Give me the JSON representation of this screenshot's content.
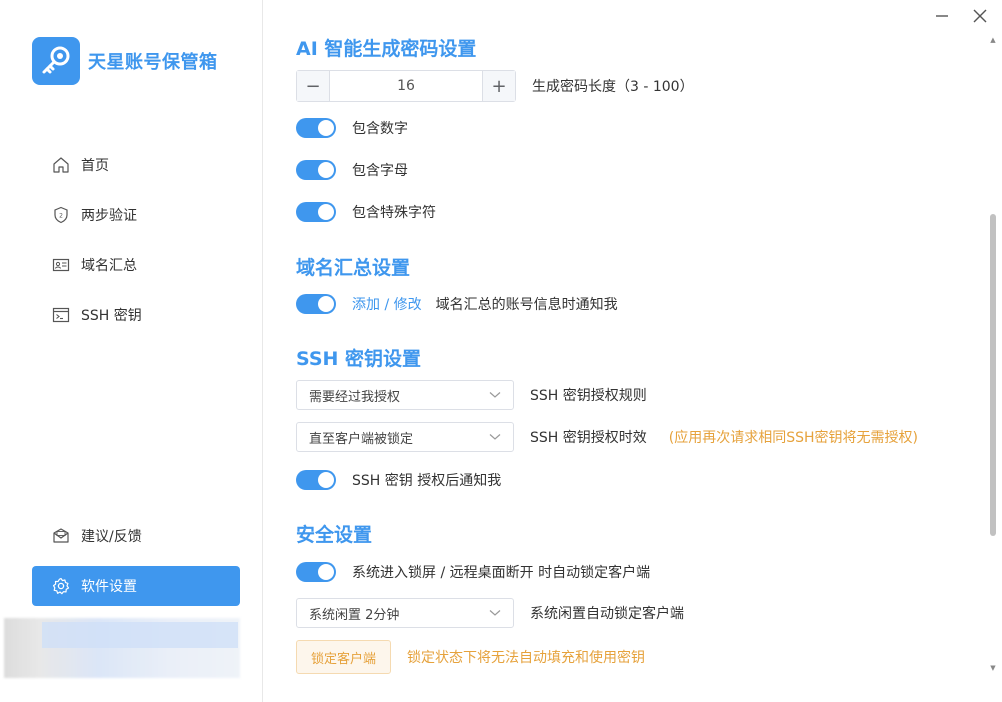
{
  "app": {
    "title": "天星账号保管箱",
    "accent": "#3f97ee",
    "warning": "#e6a23c"
  },
  "sidebar": {
    "items": [
      {
        "label": "首页",
        "icon": "home-icon"
      },
      {
        "label": "两步验证",
        "icon": "shield-icon"
      },
      {
        "label": "域名汇总",
        "icon": "id-card-icon"
      },
      {
        "label": "SSH 密钥",
        "icon": "terminal-icon"
      }
    ],
    "bottom_items": [
      {
        "label": "建议/反馈",
        "icon": "mail-icon"
      },
      {
        "label": "软件设置",
        "icon": "gear-icon",
        "active": true
      }
    ]
  },
  "ai": {
    "title": "AI 智能生成密码设置",
    "length_value": "16",
    "length_label": "生成密码长度（3 - 100）",
    "include_digits": "包含数字",
    "include_letters": "包含字母",
    "include_special": "包含特殊字符"
  },
  "domain": {
    "title": "域名汇总设置",
    "link": "添加 / 修改",
    "notify_label": "域名汇总的账号信息时通知我"
  },
  "ssh": {
    "title": "SSH 密钥设置",
    "rule_value": "需要经过我授权",
    "rule_label": "SSH 密钥授权规则",
    "expiry_value": "直至客户端被锁定",
    "expiry_label": "SSH 密钥授权时效",
    "expiry_note": "(应用再次请求相同SSH密钥将无需授权)",
    "notify_label": "SSH 密钥 授权后通知我"
  },
  "security": {
    "title": "安全设置",
    "lock_on_screen": "系统进入锁屏 / 远程桌面断开 时自动锁定客户端",
    "idle_value": "系统闲置 2分钟",
    "idle_label": "系统闲置自动锁定客户端",
    "lock_button": "锁定客户端",
    "lock_note": "锁定状态下将无法自动填充和使用密钥"
  }
}
